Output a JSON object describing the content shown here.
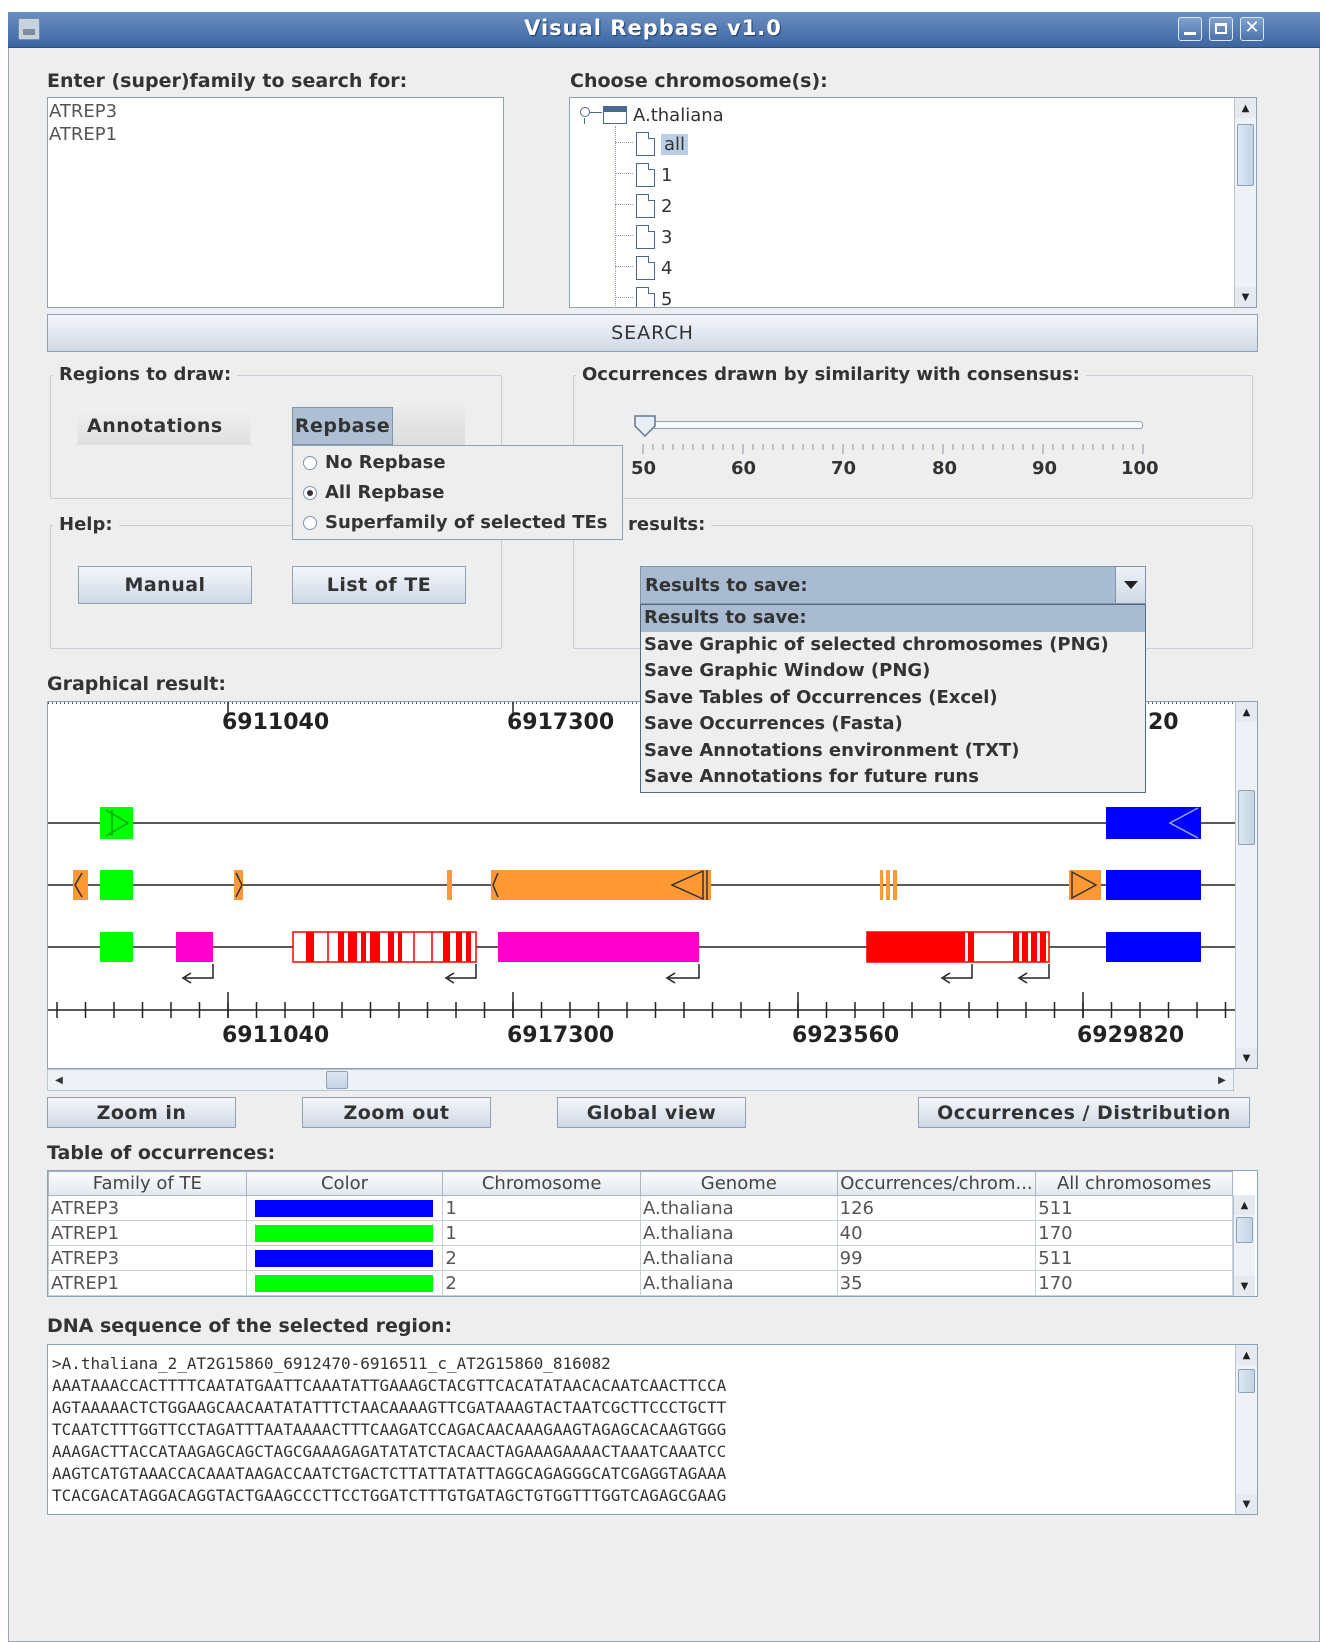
{
  "window": {
    "title": "Visual Repbase v1.0"
  },
  "search": {
    "label": "Enter (super)family to search for:",
    "families": [
      "ATREP3",
      "ATREP1"
    ],
    "chromosome_label": "Choose chromosome(s):",
    "tree_root": "A.thaliana",
    "tree_items": [
      "all",
      "1",
      "2",
      "3",
      "4",
      "5"
    ],
    "button": "SEARCH"
  },
  "regions": {
    "legend": "Regions to draw:",
    "tab_annotations": "Annotations",
    "tab_repbase": "Repbase",
    "options": [
      "No Repbase",
      "All Repbase",
      "Superfamily of selected TEs"
    ],
    "selected_option": "All Repbase"
  },
  "similarity": {
    "legend": "Occurrences drawn by similarity with consensus:",
    "ticks": [
      "50",
      "60",
      "70",
      "80",
      "90",
      "100"
    ],
    "value": 50
  },
  "help": {
    "legend": "Help:",
    "manual": "Manual",
    "list_te": "List of TE"
  },
  "save": {
    "legend_fragment": "results:",
    "selected": "Results to save:",
    "options": [
      "Results to save:",
      "Save Graphic of selected chromosomes (PNG)",
      "Save Graphic Window (PNG)",
      "Save Tables of Occurrences (Excel)",
      "Save Occurrences (Fasta)",
      "Save Annotations environment (TXT)",
      "Save Annotations for future runs"
    ]
  },
  "graph": {
    "label": "Graphical result:",
    "top_ticks": [
      "6911040",
      "6917300",
      "20"
    ],
    "bottom_ticks": [
      "6911040",
      "6917300",
      "6923560",
      "6929820"
    ]
  },
  "nav": {
    "zoom_in": "Zoom in",
    "zoom_out": "Zoom out",
    "global_view": "Global view",
    "occ_dist": "Occurrences / Distribution"
  },
  "table": {
    "label": "Table of occurrences:",
    "headers": [
      "Family of TE",
      "Color",
      "Chromosome",
      "Genome",
      "Occurrences/chrom...",
      "All chromosomes"
    ],
    "rows": [
      {
        "family": "ATREP3",
        "color": "#0000ff",
        "chromosome": "1",
        "genome": "A.thaliana",
        "occ": "126",
        "all": "511"
      },
      {
        "family": "ATREP1",
        "color": "#00ff00",
        "chromosome": "1",
        "genome": "A.thaliana",
        "occ": "40",
        "all": "170"
      },
      {
        "family": "ATREP3",
        "color": "#0000ff",
        "chromosome": "2",
        "genome": "A.thaliana",
        "occ": "99",
        "all": "511"
      },
      {
        "family": "ATREP1",
        "color": "#00ff00",
        "chromosome": "2",
        "genome": "A.thaliana",
        "occ": "35",
        "all": "170"
      }
    ]
  },
  "dna": {
    "label": "DNA sequence of the selected region:",
    "lines": [
      ">A.thaliana_2_AT2G15860_6912470-6916511_c_AT2G15860_816082",
      "AAATAAACCACTTTTCAATATGAATTCAAATATTGAAAGCTACGTTCACATATAACACAATCAACTTCCA",
      "AGTAAAAACTCTGGAAGCAACAATATATTTCTAACAAAAGTTCGATAAAGTACTAATCGCTTCCCTGCTT",
      "TCAATCTTTGGTTCCTAGATTTAATAAAACTTTCAAGATCCAGACAACAAAGAAGTAGAGCACAAGTGGG",
      "AAAGACTTACCATAAGAGCAGCTAGCGAAAGAGATATATCTACAACTAGAAAGAAAACTAAATCAAATCC",
      "AAGTCATGTAAACCACAAATAAGACCAATCTGACTCTTATTATATTAGGCAGAGGGCATCGAGGTAGAAA",
      "TCACGACATAGGACAGGTACTGAAGCCCTTCCTGGATCTTTGTGATAGCTGTGGTTTGGTCAGAGCGAAG"
    ]
  }
}
